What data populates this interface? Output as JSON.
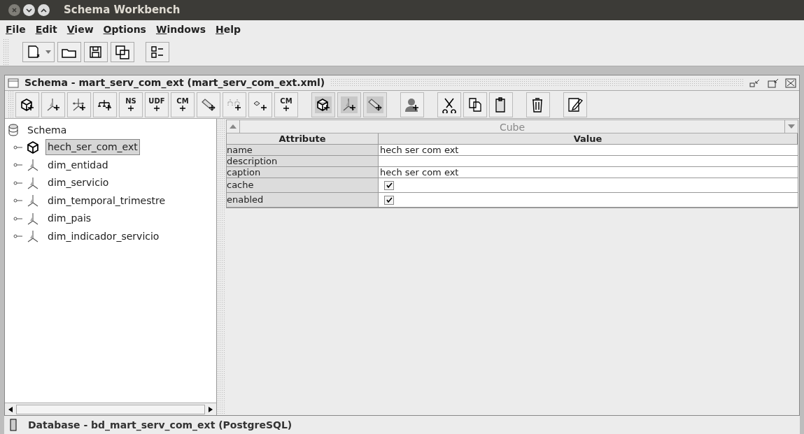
{
  "window": {
    "title": "Schema Workbench"
  },
  "menu": [
    "File",
    "Edit",
    "View",
    "Options",
    "Windows",
    "Help"
  ],
  "main_toolbar": [
    {
      "kind": "new",
      "dropdown": true
    },
    {
      "kind": "open"
    },
    {
      "kind": "save"
    },
    {
      "kind": "save-as"
    },
    {
      "kind": "preferences"
    }
  ],
  "document": {
    "title": "Schema - mart_serv_com_ext (mart_serv_com_ext.xml)",
    "toolbar": [
      [
        {
          "kind": "cube",
          "shaded": false
        },
        {
          "kind": "dimension",
          "shaded": false
        },
        {
          "kind": "dimension-usage",
          "shaded": false
        },
        {
          "kind": "hierarchy",
          "shaded": false
        },
        {
          "kind": "text",
          "label": "NS",
          "shaded": false
        },
        {
          "kind": "text",
          "label": "UDF",
          "shaded": false
        },
        {
          "kind": "text",
          "label": "CM",
          "shaded": false
        },
        {
          "kind": "measure",
          "shaded": false
        },
        {
          "kind": "level",
          "shaded": false
        },
        {
          "kind": "property",
          "shaded": false
        },
        {
          "kind": "text",
          "label": "CM",
          "shaded": false
        }
      ],
      [
        {
          "kind": "cube",
          "shaded": true
        },
        {
          "kind": "dimension",
          "shaded": true
        },
        {
          "kind": "measure",
          "shaded": true
        }
      ],
      [
        {
          "kind": "role",
          "shaded": false
        }
      ],
      [
        {
          "kind": "cut",
          "shaded": false
        },
        {
          "kind": "copy",
          "shaded": false
        },
        {
          "kind": "paste",
          "shaded": false
        }
      ],
      [
        {
          "kind": "delete",
          "shaded": false
        }
      ],
      [
        {
          "kind": "edit",
          "shaded": false
        }
      ]
    ],
    "tree": {
      "label": "Schema",
      "children": [
        {
          "label": "hech_ser_com_ext",
          "kind": "cube",
          "selected": true
        },
        {
          "label": "dim_entidad",
          "kind": "dimension",
          "selected": false
        },
        {
          "label": "dim_servicio",
          "kind": "dimension",
          "selected": false
        },
        {
          "label": "dim_temporal_trimestre",
          "kind": "dimension",
          "selected": false
        },
        {
          "label": "dim_pais",
          "kind": "dimension",
          "selected": false
        },
        {
          "label": "dim_indicador_servicio",
          "kind": "dimension",
          "selected": false
        }
      ]
    },
    "panel": {
      "title": "Cube",
      "columns": [
        "Attribute",
        "Value"
      ],
      "rows": [
        {
          "attribute": "name",
          "kind": "text",
          "value": "hech ser com ext"
        },
        {
          "attribute": "description",
          "kind": "text"
        },
        {
          "attribute": "caption",
          "kind": "text",
          "value": "hech ser com ext"
        },
        {
          "attribute": "cache",
          "kind": "checkbox",
          "checked": true
        },
        {
          "attribute": "enabled",
          "kind": "checkbox",
          "checked": true
        }
      ]
    }
  },
  "status_bar": {
    "text": "Database - bd_mart_serv_com_ext (PostgreSQL)"
  }
}
